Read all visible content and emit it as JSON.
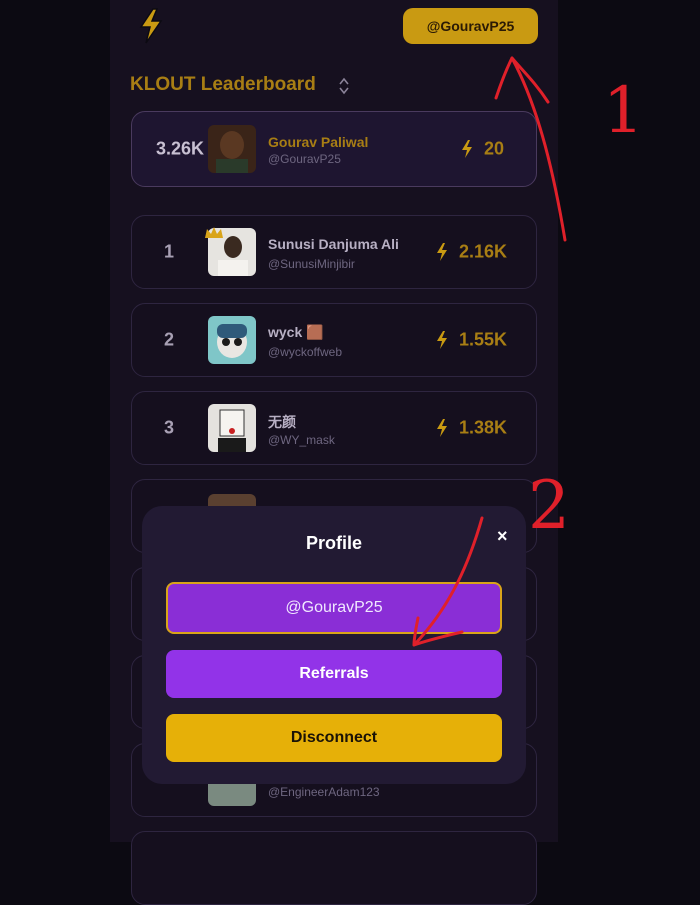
{
  "header": {
    "user_button": "@GouravP25"
  },
  "leaderboard": {
    "title": "KLOUT Leaderboard",
    "current_user": {
      "score": "3.26K",
      "name": "Gourav Paliwal",
      "handle": "@GouravP25",
      "rank": "20"
    },
    "rows": [
      {
        "rank": "1",
        "name": "Sunusi Danjuma Ali",
        "handle": "@SunusiMinjibir",
        "score": "2.16K"
      },
      {
        "rank": "2",
        "name": "wyck 🟫",
        "handle": "@wyckoffweb",
        "score": "1.55K"
      },
      {
        "rank": "3",
        "name": "无颜",
        "handle": "@WY_mask",
        "score": "1.38K"
      },
      {
        "handle": "@EngineerAdam123"
      }
    ]
  },
  "modal": {
    "title": "Profile",
    "close": "×",
    "handle_button": "@GouravP25",
    "referrals_button": "Referrals",
    "disconnect_button": "Disconnect"
  },
  "annotations": {
    "one": "1",
    "two": "2"
  },
  "colors": {
    "accent_gold": "#c99a12",
    "purple": "#9233e8",
    "annotation_red": "#e0202a"
  }
}
